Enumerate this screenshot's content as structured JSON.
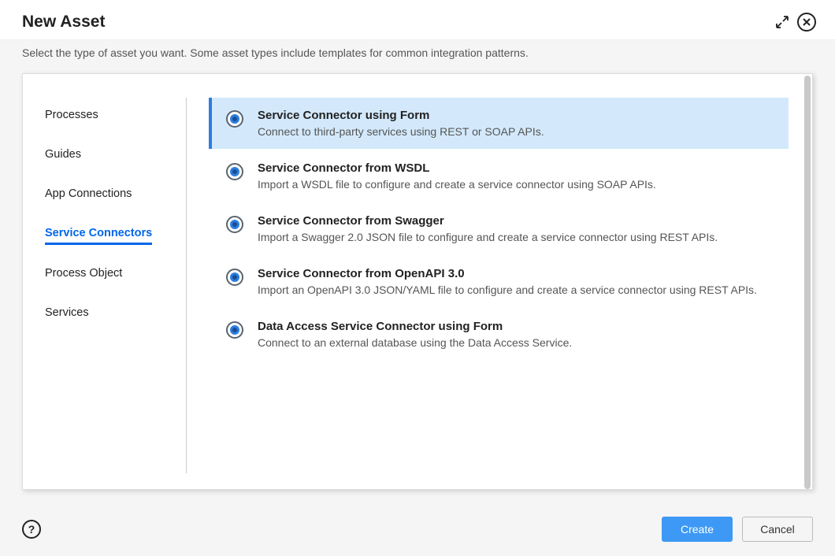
{
  "header": {
    "title": "New Asset"
  },
  "subtitle": "Select the type of asset you want. Some asset types include templates for common integration patterns.",
  "sidebar": {
    "items": [
      {
        "label": "Processes",
        "active": false
      },
      {
        "label": "Guides",
        "active": false
      },
      {
        "label": "App Connections",
        "active": false
      },
      {
        "label": "Service Connectors",
        "active": true
      },
      {
        "label": "Process Object",
        "active": false
      },
      {
        "label": "Services",
        "active": false
      }
    ]
  },
  "options": [
    {
      "title": "Service Connector using Form",
      "desc": "Connect to third-party services using REST or SOAP APIs.",
      "selected": true
    },
    {
      "title": "Service Connector from WSDL",
      "desc": "Import a WSDL file to configure and create a service connector using SOAP APIs.",
      "selected": false
    },
    {
      "title": "Service Connector from Swagger",
      "desc": "Import a Swagger 2.0 JSON file to configure and create a service connector using REST APIs.",
      "selected": false
    },
    {
      "title": "Service Connector from OpenAPI 3.0",
      "desc": "Import an OpenAPI 3.0 JSON/YAML file to configure and create a service connector using REST APIs.",
      "selected": false
    },
    {
      "title": "Data Access Service Connector using Form",
      "desc": "Connect to an external database using the Data Access Service.",
      "selected": false
    }
  ],
  "footer": {
    "help": "?",
    "create": "Create",
    "cancel": "Cancel"
  }
}
